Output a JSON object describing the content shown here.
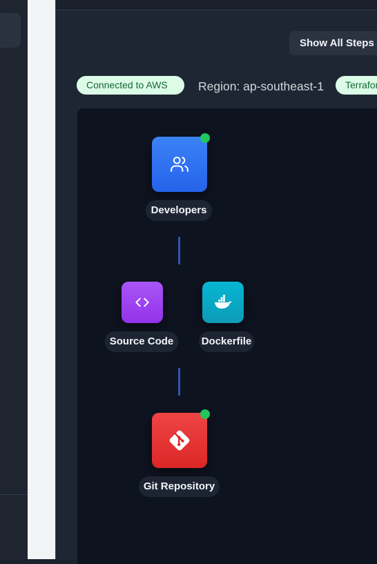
{
  "toolbar": {
    "show_steps_label": "Show All Steps"
  },
  "status": {
    "connection": "Connected to AWS",
    "region": "Region: ap-southeast-1",
    "terraform": "Terraform"
  },
  "pipeline": {
    "nodes": [
      {
        "label": "Developers",
        "icon": "users-icon",
        "color": "#3b82f6",
        "online": true
      },
      {
        "label": "Source Code",
        "icon": "code-icon",
        "color": "#a855f7",
        "online": false
      },
      {
        "label": "Dockerfile",
        "icon": "docker-icon",
        "color": "#06b6d4",
        "online": false
      },
      {
        "label": "Git Repository",
        "icon": "git-icon",
        "color": "#ef4444",
        "online": true
      }
    ],
    "status_color": "#22c55e"
  }
}
